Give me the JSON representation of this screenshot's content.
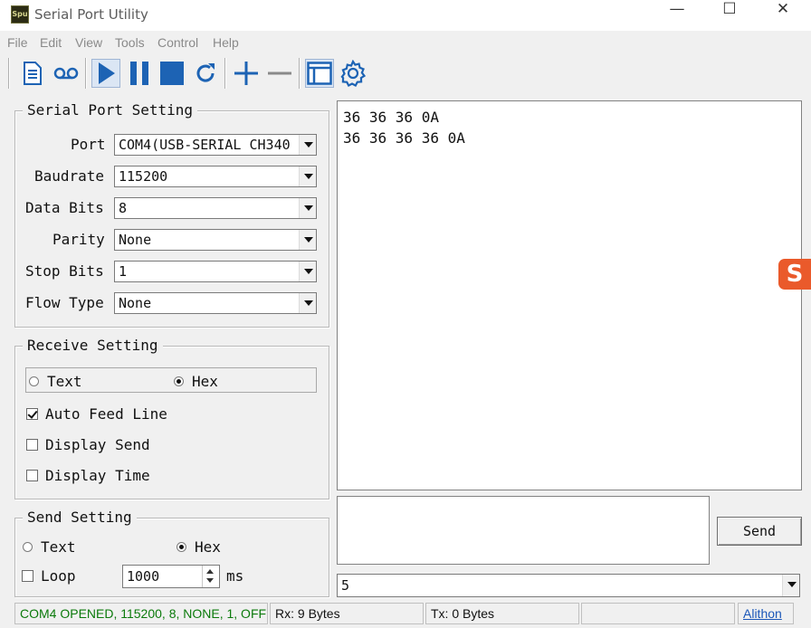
{
  "window": {
    "title": "Serial Port Utility",
    "icon_text": "Spu",
    "controls": {
      "minimize": "—",
      "maximize": "☐",
      "close": "✕"
    }
  },
  "menu": [
    "File",
    "Edit",
    "View",
    "Tools",
    "Control",
    "Help"
  ],
  "toolbar": {
    "icons": [
      "new-document-icon",
      "record-icon",
      "play-icon",
      "pause-icon",
      "stop-icon",
      "refresh-icon",
      "add-icon",
      "remove-icon",
      "window-icon",
      "settings-icon"
    ],
    "accent": "#1d63b4"
  },
  "serial_port_setting": {
    "title": "Serial Port Setting",
    "fields": [
      {
        "label": "Port",
        "value": "COM4(USB-SERIAL CH340"
      },
      {
        "label": "Baudrate",
        "value": "115200"
      },
      {
        "label": "Data Bits",
        "value": "8"
      },
      {
        "label": "Parity",
        "value": "None"
      },
      {
        "label": "Stop Bits",
        "value": "1"
      },
      {
        "label": "Flow Type",
        "value": "None"
      }
    ]
  },
  "receive_setting": {
    "title": "Receive Setting",
    "text_label": "Text",
    "hex_label": "Hex",
    "selected": "Hex",
    "auto_feed_line": {
      "label": "Auto Feed Line",
      "checked": true
    },
    "display_send": {
      "label": "Display Send",
      "checked": false
    },
    "display_time": {
      "label": "Display Time",
      "checked": false
    }
  },
  "send_setting": {
    "title": "Send Setting",
    "text_label": "Text",
    "hex_label": "Hex",
    "selected": "Hex",
    "loop_label": "Loop",
    "loop_checked": false,
    "interval": "1000",
    "unit": "ms"
  },
  "receive_area": {
    "lines": [
      "36 36 36 0A",
      "36 36 36 36 0A"
    ]
  },
  "send_area": {
    "text": "",
    "send_button": "Send",
    "history_value": "5"
  },
  "status_bar": {
    "connection": "COM4 OPENED, 115200, 8, NONE, 1, OFF",
    "connection_color": "#0b7a0b",
    "rx": "Rx: 9 Bytes",
    "tx": "Tx: 0 Bytes",
    "brand": "Alithon",
    "brand_color": "#1a56b8"
  },
  "overlay": {
    "sogou_label": "S",
    "color": "#ea5a2b"
  }
}
